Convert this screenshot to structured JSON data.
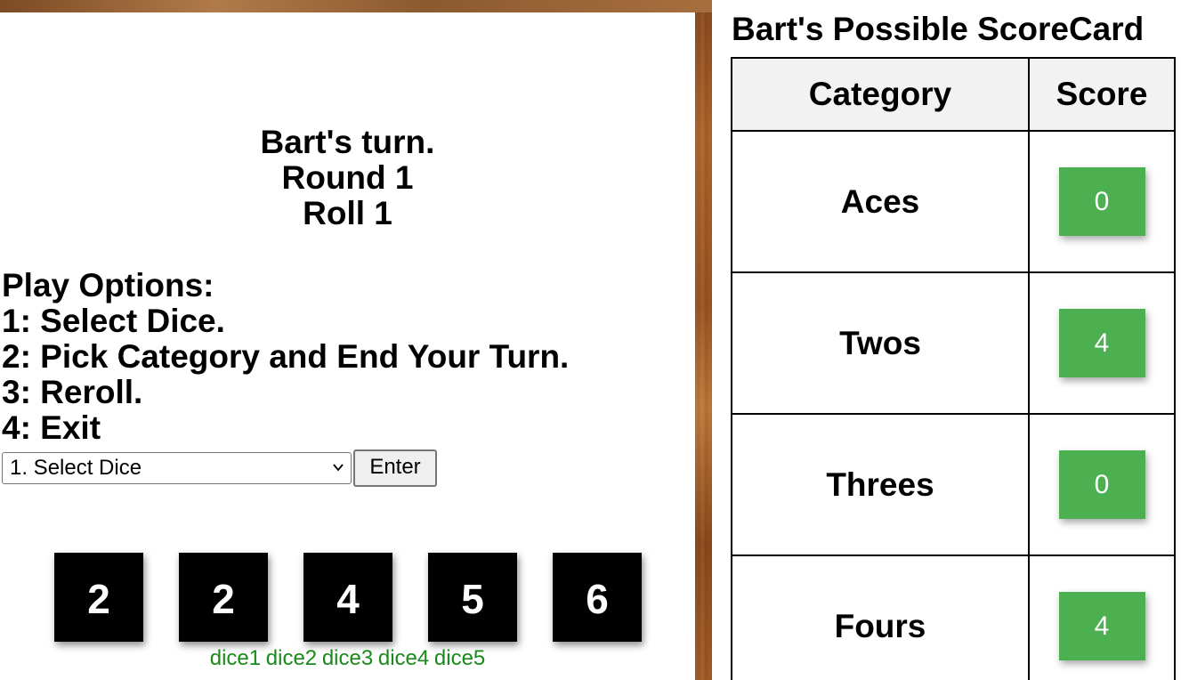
{
  "game": {
    "status": {
      "turn": "Bart's turn.",
      "round": "Round 1",
      "roll": "Roll 1"
    },
    "options": {
      "heading": "Play Options:",
      "items": [
        "1: Select Dice.",
        "2: Pick Category and End Your Turn.",
        "3: Reroll.",
        "4: Exit"
      ]
    },
    "select": {
      "selected": "1. Select Dice"
    },
    "enter_label": "Enter",
    "dice": [
      {
        "value": "2",
        "label": "dice1"
      },
      {
        "value": "2",
        "label": "dice2"
      },
      {
        "value": "4",
        "label": "dice3"
      },
      {
        "value": "5",
        "label": "dice4"
      },
      {
        "value": "6",
        "label": "dice5"
      }
    ]
  },
  "scorecard": {
    "title": "Bart's Possible ScoreCard",
    "headers": {
      "category": "Category",
      "score": "Score"
    },
    "rows": [
      {
        "category": "Aces",
        "score": "0"
      },
      {
        "category": "Twos",
        "score": "4"
      },
      {
        "category": "Threes",
        "score": "0"
      },
      {
        "category": "Fours",
        "score": "4"
      }
    ]
  },
  "colors": {
    "score_button": "#4caf50",
    "dice_label": "#1a8a1a",
    "die_background": "#000000"
  }
}
